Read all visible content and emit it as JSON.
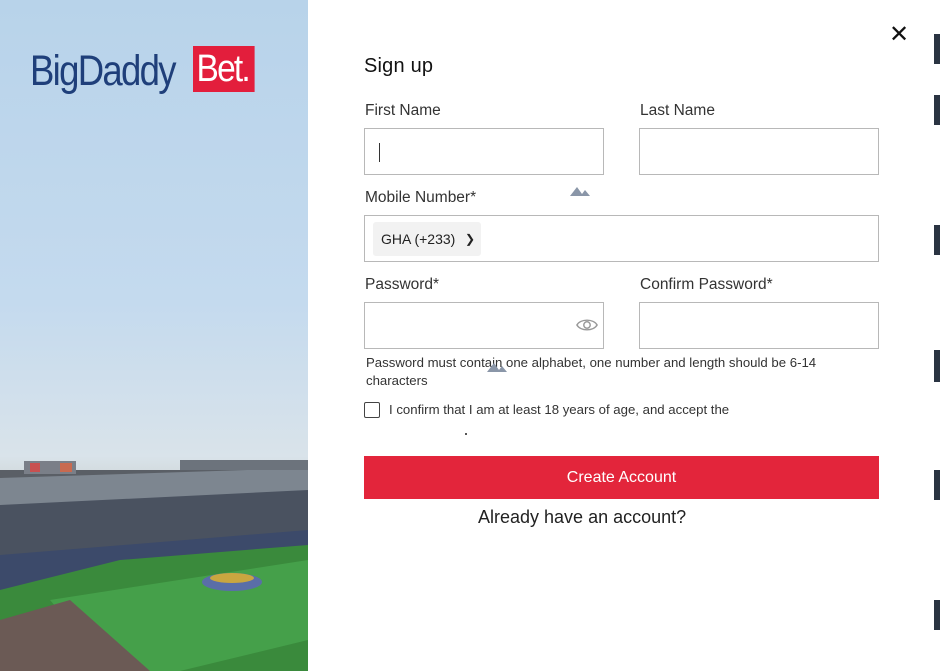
{
  "brand": {
    "logo_text_part1": "BigDaddy",
    "logo_text_part2": "Bet.",
    "primary_color": "#1f3f7a",
    "accent_color": "#e31e3c"
  },
  "form": {
    "title": "Sign up",
    "first_name_label": "First Name",
    "last_name_label": "Last Name",
    "mobile_label": "Mobile Number*",
    "country_code": "GHA (+233)",
    "password_label": "Password*",
    "confirm_password_label": "Confirm Password*",
    "password_hint": "Password must contain one alphabet, one number and length should be 6-14 characters",
    "age_confirm_text": "I confirm that I am at least 18 years of age, and accept the",
    "submit_label": "Create Account",
    "login_link_text": "Already have an account?"
  },
  "icons": {
    "close": "close-icon",
    "eye": "eye-icon",
    "dropdown": "chevron-down-icon"
  }
}
